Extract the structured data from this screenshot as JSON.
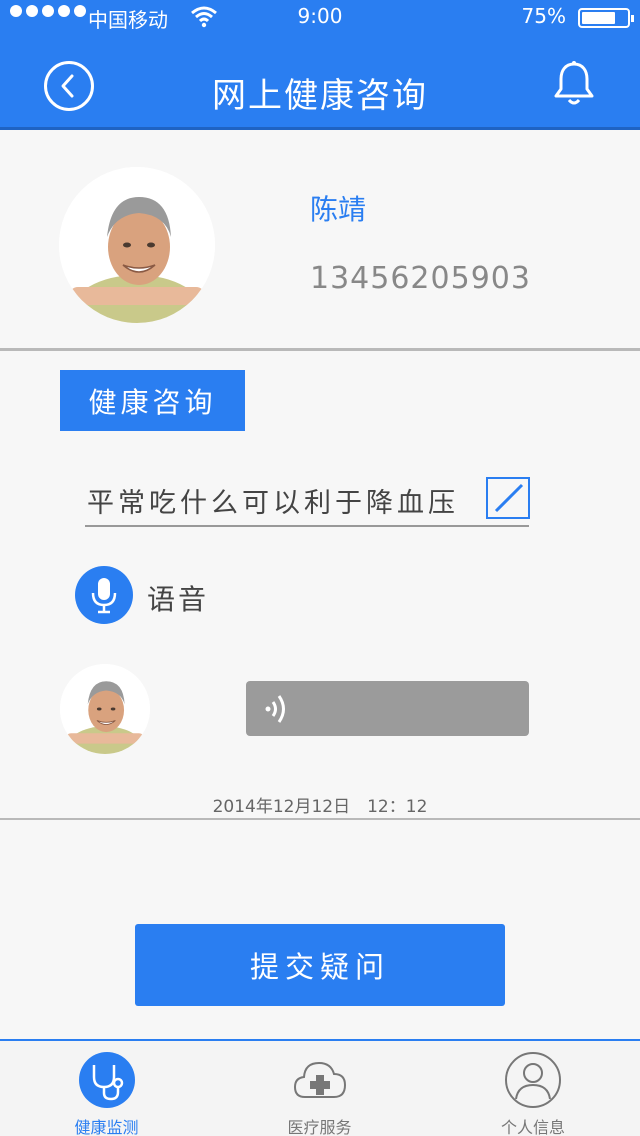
{
  "status_bar": {
    "carrier": "中国移动",
    "time": "9:00",
    "battery_text": "75%",
    "battery_level": 0.75
  },
  "header": {
    "title": "网上健康咨询",
    "back_icon": "chevron-left-circle-icon",
    "bell_icon": "bell-icon"
  },
  "profile": {
    "name": "陈靖",
    "phone": "13456205903"
  },
  "consult": {
    "section_label": "健康咨询",
    "question": "平常吃什么可以利于降血压",
    "voice_label": "语音",
    "timestamp": "2014年12月12日　12：12"
  },
  "submit_label": "提交疑问",
  "tabs": [
    {
      "label": "健康监测",
      "icon": "stethoscope-icon",
      "active": true
    },
    {
      "label": "医疗服务",
      "icon": "cloud-plus-icon",
      "active": false
    },
    {
      "label": "个人信息",
      "icon": "person-icon",
      "active": false
    }
  ],
  "colors": {
    "primary": "#2a7ef1",
    "bubble": "#9b9b9b",
    "background": "#f7f7f7"
  }
}
